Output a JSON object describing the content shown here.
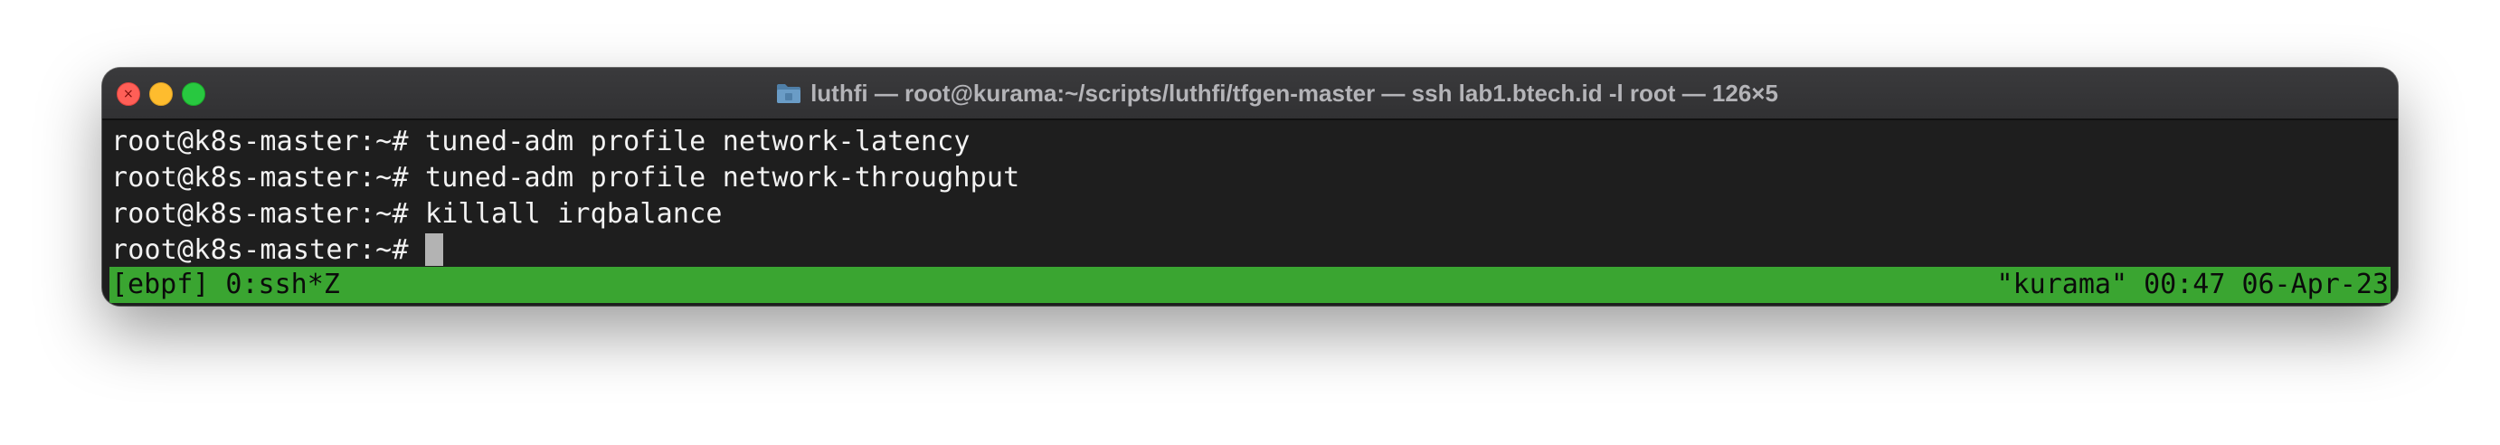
{
  "window": {
    "title": "luthfi — root@kurama:~/scripts/luthfi/tfgen-master — ssh lab1.btech.id -l root — 126×5",
    "title_icon": "folder-icon",
    "traffic_lights": {
      "close_color": "#ff5f57",
      "minimize_color": "#febc2e",
      "maximize_color": "#28c840"
    }
  },
  "terminal": {
    "background": "#1e1e1e",
    "foreground": "#f2f2f2",
    "lines": [
      {
        "prompt": "root@k8s-master:~#",
        "command": " tuned-adm profile network-latency"
      },
      {
        "prompt": "root@k8s-master:~#",
        "command": " tuned-adm profile network-throughput"
      },
      {
        "prompt": "root@k8s-master:~#",
        "command": " killall irqbalance"
      },
      {
        "prompt": "root@k8s-master:~#",
        "command": ""
      }
    ]
  },
  "tmux_status": {
    "background": "#3aa531",
    "left": "[ebpf] 0:ssh*Z",
    "right": "\"kurama\" 00:47 06-Apr-23"
  }
}
